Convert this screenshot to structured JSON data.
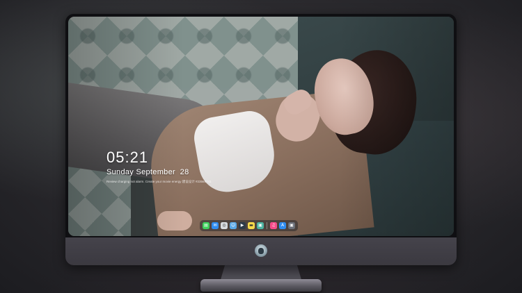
{
  "lock_screen": {
    "time": "05:21",
    "date": "Sunday September  28",
    "status_line": "Review charging not alarm. Create your movie energy 建设设计 #23568741"
  },
  "dock": {
    "items": [
      {
        "name": "messages-icon",
        "glyph": "▤",
        "color": "#3ecf5c"
      },
      {
        "name": "mail-icon",
        "glyph": "✉",
        "color": "#2f8cf0"
      },
      {
        "name": "safari-icon",
        "glyph": "◎",
        "color": "#d8dce0"
      },
      {
        "name": "finder-icon",
        "glyph": "☺",
        "color": "#5aa8e6"
      },
      {
        "name": "video-editor-icon",
        "glyph": "▶",
        "color": "#2d3a48"
      },
      {
        "name": "notes-icon",
        "glyph": "▬",
        "color": "#f6d94a"
      },
      {
        "name": "photo-app-icon",
        "glyph": "▣",
        "color": "#4bb3a2"
      },
      {
        "name": "music-icon",
        "glyph": "♫",
        "color": "#f54b8a"
      },
      {
        "name": "app-store-icon",
        "glyph": "A",
        "color": "#2f8cf0"
      },
      {
        "name": "camera-icon",
        "glyph": "▣",
        "color": "#6b6f78"
      }
    ]
  },
  "monitor": {
    "logo": "helmet-logo-icon"
  }
}
